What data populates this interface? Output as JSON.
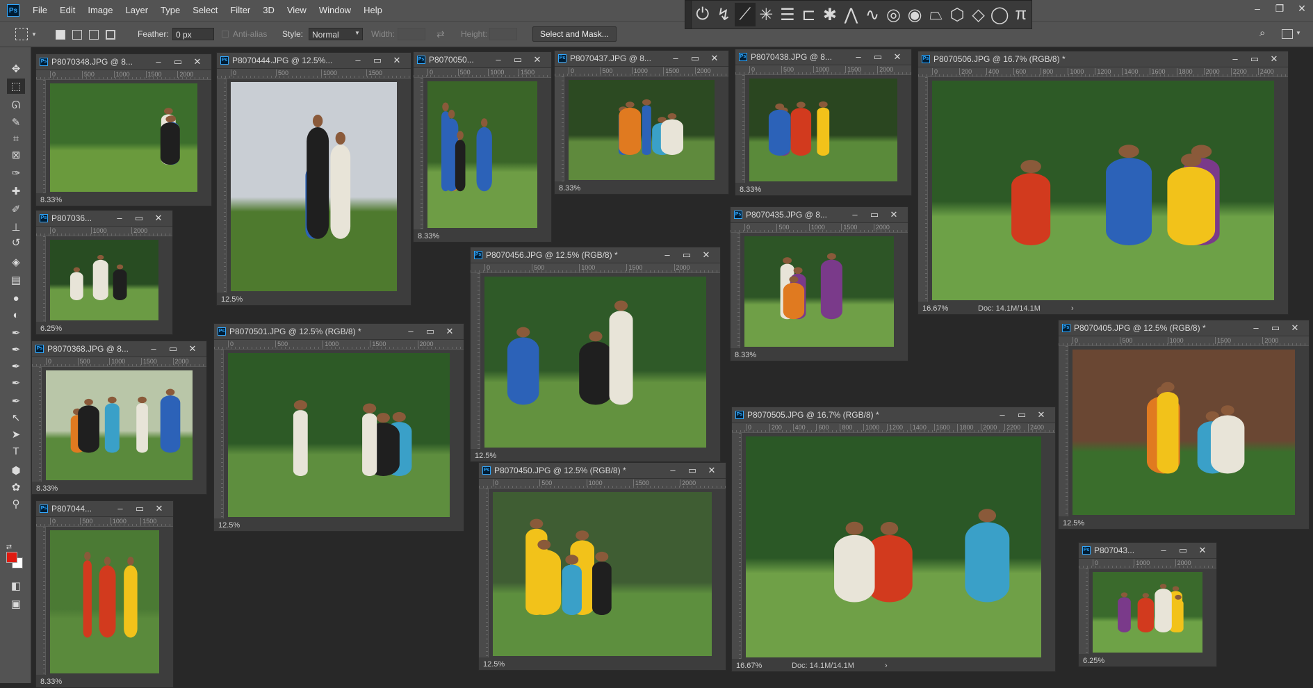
{
  "app": {
    "logo": "Ps"
  },
  "menu": [
    "File",
    "Edit",
    "Image",
    "Layer",
    "Type",
    "Select",
    "Filter",
    "3D",
    "View",
    "Window",
    "Help"
  ],
  "options": {
    "feather_label": "Feather:",
    "feather_value": "0 px",
    "antialias_label": "Anti-alias",
    "style_label": "Style:",
    "style_value": "Normal",
    "width_label": "Width:",
    "height_label": "Height:",
    "select_mask_label": "Select and Mask..."
  },
  "extension_icons": [
    "power-icon",
    "lasso-pen-icon",
    "line-pen-icon",
    "starburst-icon",
    "align-lines-icon",
    "bracket-icon",
    "asterisk-icon",
    "triangle-icon",
    "wave-icon",
    "spiral-icon",
    "double-spiral-icon",
    "trapezoid-icon",
    "cube-icon",
    "diamond-icon",
    "circle-icon",
    "pi-icon"
  ],
  "tools": [
    "move-icon",
    "marquee-icon",
    "lasso-icon",
    "quick-select-icon",
    "crop-icon",
    "frame-icon",
    "eyedropper-icon",
    "healing-icon",
    "brush-icon",
    "stamp-icon",
    "history-brush-icon",
    "eraser-icon",
    "gradient-icon",
    "blur-icon",
    "dodge-icon",
    "pen-icon",
    "pen-2-icon",
    "pen-3-icon",
    "pen-4-icon",
    "pen-5-icon",
    "path-select-icon",
    "direct-select-icon",
    "text-icon",
    "shape-icon",
    "custom-shape-icon",
    "zoom-icon",
    "swap-colors-icon",
    "quick-mask-icon",
    "screen-mode-icon"
  ],
  "colors": {
    "foreground": "#e01a10",
    "background": "#ffffff",
    "accent": "#31a8ff"
  },
  "documents": [
    {
      "id": "d1",
      "title": "P8070348.JPG @ 8...",
      "zoom": "8.33%",
      "ruler": [
        "0",
        "500",
        "1000",
        "1500",
        "2000"
      ]
    },
    {
      "id": "d2",
      "title": "P8070444.JPG @ 12.5%...",
      "zoom": "12.5%",
      "ruler": [
        "0",
        "500",
        "1000",
        "1500"
      ]
    },
    {
      "id": "d3",
      "title": "P8070050...",
      "zoom": "8.33%",
      "ruler": [
        "0",
        "500",
        "1000",
        "1500"
      ]
    },
    {
      "id": "d4",
      "title": "P8070437.JPG @ 8...",
      "zoom": "8.33%",
      "ruler": [
        "0",
        "500",
        "1000",
        "1500",
        "2000"
      ]
    },
    {
      "id": "d5",
      "title": "P8070438.JPG @ 8...",
      "zoom": "8.33%",
      "ruler": [
        "0",
        "500",
        "1000",
        "1500",
        "2000"
      ]
    },
    {
      "id": "d6",
      "title": "P8070506.JPG @ 16.7% (RGB/8) *",
      "zoom": "16.67%",
      "doc": "Doc: 14.1M/14.1M",
      "ruler": [
        "0",
        "200",
        "400",
        "600",
        "800",
        "1000",
        "1200",
        "1400",
        "1600",
        "1800",
        "2000",
        "2200",
        "2400"
      ]
    },
    {
      "id": "d7",
      "title": "P807036...",
      "zoom": "6.25%",
      "ruler": [
        "0",
        "1000",
        "2000"
      ]
    },
    {
      "id": "d8",
      "title": "P8070456.JPG @ 12.5% (RGB/8) *",
      "zoom": "12.5%",
      "ruler": [
        "0",
        "500",
        "1000",
        "1500",
        "2000"
      ]
    },
    {
      "id": "d9",
      "title": "P8070435.JPG @ 8...",
      "zoom": "8.33%",
      "ruler": [
        "0",
        "500",
        "1000",
        "1500",
        "2000"
      ]
    },
    {
      "id": "d10",
      "title": "P8070368.JPG @ 8...",
      "zoom": "8.33%",
      "ruler": [
        "0",
        "500",
        "1000",
        "1500",
        "2000"
      ]
    },
    {
      "id": "d11",
      "title": "P8070501.JPG @ 12.5% (RGB/8) *",
      "zoom": "12.5%",
      "ruler": [
        "0",
        "500",
        "1000",
        "1500",
        "2000"
      ]
    },
    {
      "id": "d12",
      "title": "P8070405.JPG @ 12.5% (RGB/8) *",
      "zoom": "12.5%",
      "ruler": [
        "0",
        "500",
        "1000",
        "1500",
        "2000"
      ]
    },
    {
      "id": "d13",
      "title": "P8070505.JPG @ 16.7% (RGB/8) *",
      "zoom": "16.67%",
      "doc": "Doc: 14.1M/14.1M",
      "ruler": [
        "0",
        "200",
        "400",
        "600",
        "800",
        "1000",
        "1200",
        "1400",
        "1600",
        "1800",
        "2000",
        "2200",
        "2400"
      ]
    },
    {
      "id": "d14",
      "title": "P807044...",
      "zoom": "8.33%",
      "ruler": [
        "0",
        "500",
        "1000",
        "1500"
      ]
    },
    {
      "id": "d15",
      "title": "P8070450.JPG @ 12.5% (RGB/8) *",
      "zoom": "12.5%",
      "ruler": [
        "0",
        "500",
        "1000",
        "1500",
        "2000"
      ]
    },
    {
      "id": "d16",
      "title": "P807043...",
      "zoom": "6.25%",
      "ruler": [
        "0",
        "1000",
        "2000"
      ]
    }
  ]
}
